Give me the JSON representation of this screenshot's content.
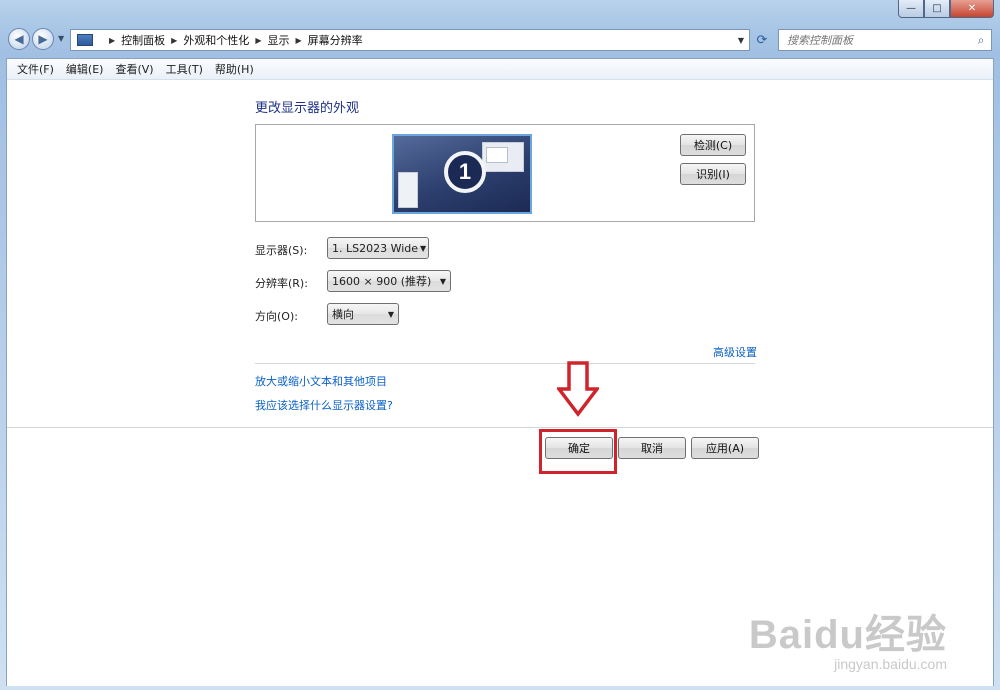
{
  "window": {
    "minimize_glyph": "—",
    "maximize_glyph": "□",
    "close_glyph": "✕"
  },
  "nav": {
    "back_glyph": "◀",
    "forward_glyph": "▶",
    "history_glyph": "▼"
  },
  "address": {
    "breadcrumbs": [
      "控制面板",
      "外观和个性化",
      "显示",
      "屏幕分辨率"
    ],
    "separator": "▶",
    "dropdown_glyph": "▼",
    "refresh_glyph": "⟳"
  },
  "search": {
    "placeholder": "搜索控制面板",
    "icon_glyph": "⌕"
  },
  "menubar": [
    "文件(F)",
    "编辑(E)",
    "查看(V)",
    "工具(T)",
    "帮助(H)"
  ],
  "main": {
    "heading": "更改显示器的外观",
    "monitor_number": "1",
    "detect_button": "检测(C)",
    "identify_button": "识别(I)",
    "display_label": "显示器(S):",
    "display_value": "1. LS2023 Wide",
    "resolution_label": "分辨率(R):",
    "resolution_value": "1600 × 900 (推荐)",
    "orientation_label": "方向(O):",
    "orientation_value": "横向",
    "dropdown_glyph": "▼",
    "advanced_link": "高级设置",
    "link_text_size": "放大或缩小文本和其他项目",
    "link_which_settings": "我应该选择什么显示器设置?"
  },
  "footer": {
    "ok_button": "确定",
    "cancel_button": "取消",
    "apply_button": "应用(A)"
  },
  "annotation": {
    "arrow_color": "#d0242c"
  },
  "watermark": {
    "logo_text": "Baidu经验",
    "url": "jingyan.baidu.com"
  },
  "colors": {
    "link": "#0a61c6",
    "heading": "#1e3287",
    "highlight": "#d0242c"
  }
}
